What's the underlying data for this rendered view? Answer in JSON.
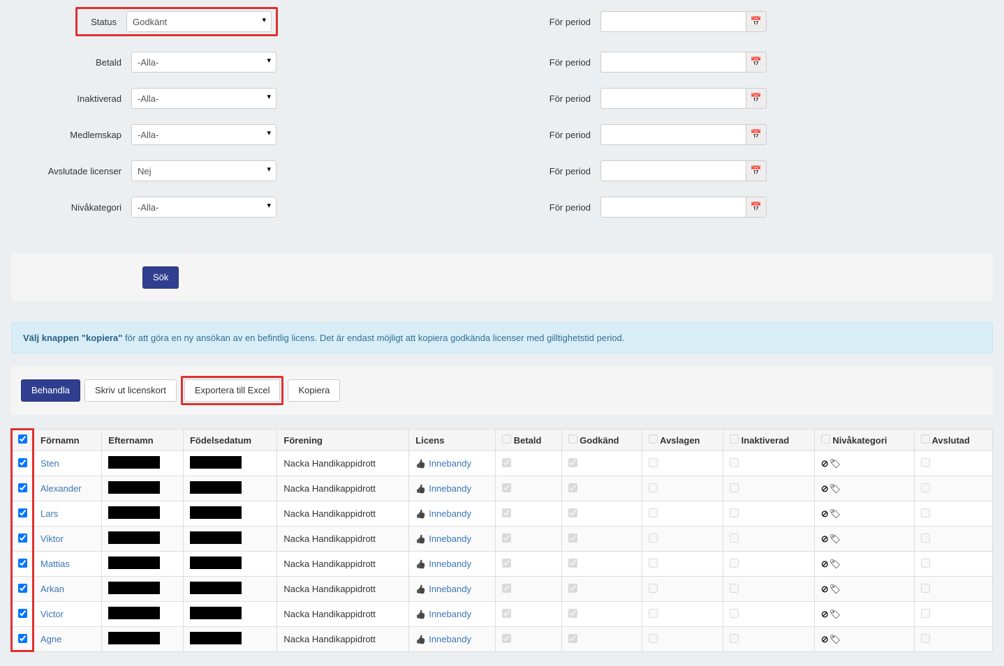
{
  "filters": {
    "status": {
      "label": "Status",
      "value": "Godkänt"
    },
    "betald": {
      "label": "Betald",
      "value": "-Alla-"
    },
    "inaktiverad": {
      "label": "Inaktiverad",
      "value": "-Alla-"
    },
    "medlemskap": {
      "label": "Medlemskap",
      "value": "-Alla-"
    },
    "avslutade": {
      "label": "Avslutade licenser",
      "value": "Nej"
    },
    "nivakategori": {
      "label": "Nivåkategori",
      "value": "-Alla-"
    },
    "period_label": "För period"
  },
  "buttons": {
    "search": "Sök",
    "behandla": "Behandla",
    "skriv_ut": "Skriv ut licenskort",
    "export": "Exportera till Excel",
    "kopiera": "Kopiera"
  },
  "alert": {
    "bold": "Välj knappen \"kopiera\"",
    "rest": " för att göra en ny ansökan av en befintlig licens. Det är endast möjligt att kopiera godkända licenser med gilltighetstid period."
  },
  "table": {
    "headers": {
      "fornamn": "Förnamn",
      "efternamn": "Efternamn",
      "fodelsedatum": "Födelsedatum",
      "forening": "Förening",
      "licens": "Licens",
      "betald": "Betald",
      "godkand": "Godkänd",
      "avslagen": "Avslagen",
      "inaktiverad": "Inaktiverad",
      "nivakategori": "Nivåkategori",
      "avslutad": "Avslutad"
    },
    "rows": [
      {
        "fornamn": "Sten",
        "forening": "Nacka Handikappidrott",
        "licens": "Innebandy",
        "betald": true,
        "godkand": true,
        "avslagen": false,
        "inaktiverad": false,
        "avslutad": false
      },
      {
        "fornamn": "Alexander",
        "forening": "Nacka Handikappidrott",
        "licens": "Innebandy",
        "betald": true,
        "godkand": true,
        "avslagen": false,
        "inaktiverad": false,
        "avslutad": false
      },
      {
        "fornamn": "Lars",
        "forening": "Nacka Handikappidrott",
        "licens": "Innebandy",
        "betald": true,
        "godkand": true,
        "avslagen": false,
        "inaktiverad": false,
        "avslutad": false
      },
      {
        "fornamn": "Viktor",
        "forening": "Nacka Handikappidrott",
        "licens": "Innebandy",
        "betald": true,
        "godkand": true,
        "avslagen": false,
        "inaktiverad": false,
        "avslutad": false
      },
      {
        "fornamn": "Mattias",
        "forening": "Nacka Handikappidrott",
        "licens": "Innebandy",
        "betald": true,
        "godkand": true,
        "avslagen": false,
        "inaktiverad": false,
        "avslutad": false
      },
      {
        "fornamn": "Arkan",
        "forening": "Nacka Handikappidrott",
        "licens": "Innebandy",
        "betald": true,
        "godkand": true,
        "avslagen": false,
        "inaktiverad": false,
        "avslutad": false
      },
      {
        "fornamn": "Victor",
        "forening": "Nacka Handikappidrott",
        "licens": "Innebandy",
        "betald": true,
        "godkand": true,
        "avslagen": false,
        "inaktiverad": false,
        "avslutad": false
      },
      {
        "fornamn": "Agne",
        "forening": "Nacka Handikappidrott",
        "licens": "Innebandy",
        "betald": true,
        "godkand": true,
        "avslagen": false,
        "inaktiverad": false,
        "avslutad": false
      }
    ]
  }
}
